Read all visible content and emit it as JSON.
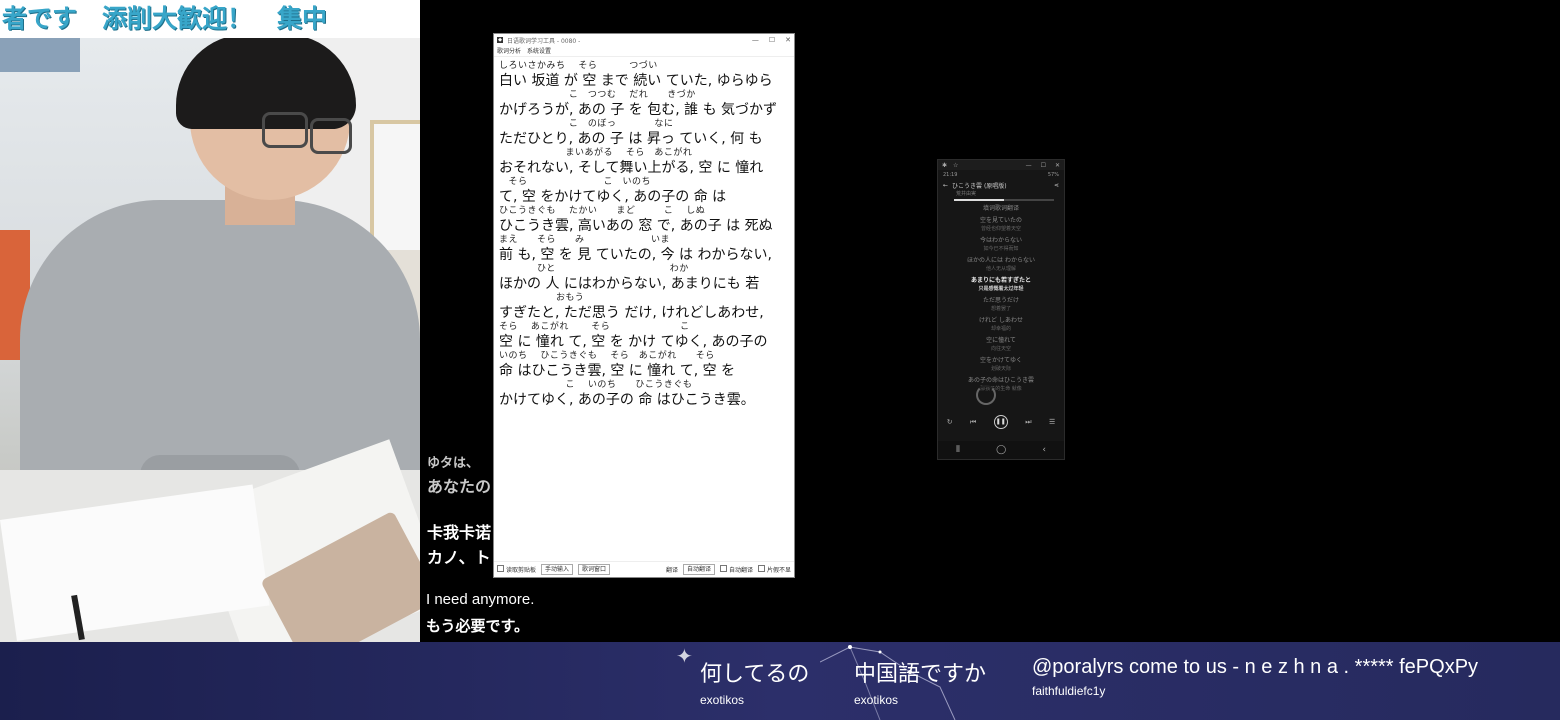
{
  "webcam": {
    "banner_text": "者です　添削大歓迎！　集中"
  },
  "subtitles": {
    "partial_top": "ゆタは、",
    "partial_line1": "あなたの",
    "partial_line2": "卡我卡诺",
    "partial_line3": "カノ、ト",
    "english": "I need anymore.",
    "japanese": "もう必要です。"
  },
  "app": {
    "title": "日语歌词学习工具 - 0080 -",
    "menu": [
      "歌词分析",
      "系统设置"
    ],
    "lines": [
      {
        "ruby": "しろいさかみち　 そら　　　 つづい",
        "text": "白い 坂道 が 空 まで 続い ていた, ゆらゆら"
      },
      {
        "ruby": "　　　　　　　 こ　つつむ　 だれ　　きづか",
        "text": "かげろうが, あの 子 を 包む, 誰 も 気づかず"
      },
      {
        "ruby": "　　　　　　　 こ　のぼっ　　　　なに",
        "text": "ただひとり, あの 子 は 昇っ ていく, 何 も"
      },
      {
        "ruby": "　　　　　　　まいあがる　 そら　あこがれ",
        "text": "おそれない, そして舞い上がる, 空 に 憧れ"
      },
      {
        "ruby": "　そら　　　　　　　　こ　いのち",
        "text": "て, 空 をかけてゆく, あの子の 命 は"
      },
      {
        "ruby": "ひこうきぐも　 たかい　　まど　　　こ　 しぬ",
        "text": "ひこうき雲, 高いあの 窓 で, あの子 は 死ぬ"
      },
      {
        "ruby": "まえ　　そら　　み　　　　　　　いま",
        "text": "前 も, 空 を 見 ていたの, 今 は わからない,"
      },
      {
        "ruby": "　　　　ひと　　　　　　　　　　　　わか",
        "text": "ほかの 人 にはわからない, あまりにも 若"
      },
      {
        "ruby": "　　　　　　おもう",
        "text": "すぎたと, ただ思う だけ, けれどしあわせ,"
      },
      {
        "ruby": "そら　 あこがれ　　 そら　　　　　　　 こ",
        "text": "空 に 憧れ て, 空 を かけ てゆく, あの子の"
      },
      {
        "ruby": "いのち　 ひこうきぐも　 そら　あこがれ　　そら",
        "text": "命 はひこうき雲, 空 に 憧れ て, 空 を"
      },
      {
        "ruby": "　　　　　　　こ　 いのち　　ひこうきぐも",
        "text": "かけてゆく, あの子の 命 はひこうき雲。"
      }
    ],
    "bottom": {
      "copy_clip": "读取剪贴板",
      "manual_input": "手动输入",
      "lyrics_window": "歌词窗口",
      "translate": "翻译",
      "auto_translate": "自动翻译",
      "auto_flip": "自动翻译",
      "hide_furigana": "片假不显"
    }
  },
  "phone": {
    "time": "21:19",
    "battery": "57%",
    "song": "ひこうき雲 (原唱版)",
    "artist": "荒井由実",
    "header_line": "填词歌词翻译",
    "lyrics": [
      {
        "jp": "空を見ていたの",
        "tr": "曾经也仰望着天空"
      },
      {
        "jp": "今はわからない",
        "tr": "如今已不得而知"
      },
      {
        "jp": "ほかの人には わからない",
        "tr": "他人无从理解"
      },
      {
        "jp": "あまりにも若すぎたと",
        "tr": "只是感慨着太过年轻"
      },
      {
        "jp": "ただ思うだけ",
        "tr": "想着罢了"
      },
      {
        "jp": "けれど しあわせ",
        "tr": "却幸福的"
      },
      {
        "jp": "空に憧れて",
        "tr": "向往天空"
      },
      {
        "jp": "空をかけてゆく",
        "tr": "划破天际"
      },
      {
        "jp": "あの子の命はひこうき雲",
        "tr": "那孩子的生命 就像"
      }
    ],
    "progress": 0.5
  },
  "chat": [
    {
      "text": "何してるの",
      "user": "exotikos"
    },
    {
      "text": "中国語ですか",
      "user": "exotikos"
    },
    {
      "text": "@poralyrs come to us - n e z h n a . ***** fePQxPy",
      "user": "faithfuldiefc1y"
    }
  ]
}
